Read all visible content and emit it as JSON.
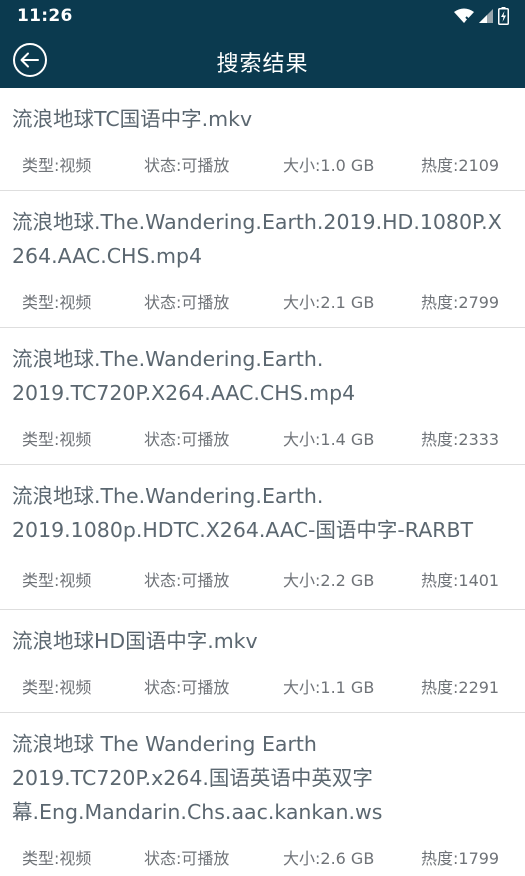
{
  "status_bar": {
    "time": "11:26",
    "icons": [
      "wifi-icon",
      "signal-icon",
      "battery-charging-icon"
    ]
  },
  "header": {
    "title": "搜索结果",
    "back_icon": "back-arrow-circle-icon"
  },
  "results": [
    {
      "title": "流浪地球TC国语中字.mkv",
      "type": "类型:视频",
      "status": "状态:可播放",
      "size": "大小:1.0 GB",
      "heat": "热度:2109"
    },
    {
      "title": "流浪地球.The.Wandering.Earth.2019.HD.1080P.X264.AAC.CHS.mp4",
      "type": "类型:视频",
      "status": "状态:可播放",
      "size": "大小:2.1 GB",
      "heat": "热度:2799"
    },
    {
      "title": "流浪地球.The.Wandering.Earth.\n2019.TC720P.X264.AAC.CHS.mp4",
      "type": "类型:视频",
      "status": "状态:可播放",
      "size": "大小:1.4 GB",
      "heat": "热度:2333"
    },
    {
      "title": "流浪地球.The.Wandering.Earth.\n2019.1080p.HDTC.X264.AAC-国语中字-RARBT",
      "type": "类型:视频",
      "status": "状态:可播放",
      "size": "大小:2.2 GB",
      "heat": "热度:1401"
    },
    {
      "title": "流浪地球HD国语中字.mkv",
      "type": "类型:视频",
      "status": "状态:可播放",
      "size": "大小:1.1 GB",
      "heat": "热度:2291"
    },
    {
      "title": "流浪地球 The Wandering Earth\n2019.TC720P.x264.国语英语中英双字\n幕.Eng.Mandarin.Chs.aac.kankan.ws",
      "type": "类型:视频",
      "status": "状态:可播放",
      "size": "大小:2.6 GB",
      "heat": "热度:1799"
    }
  ]
}
